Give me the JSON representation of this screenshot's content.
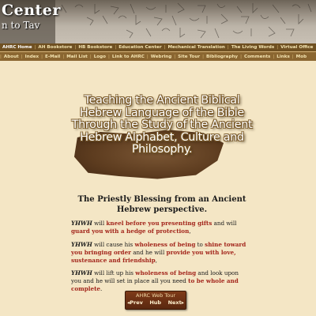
{
  "header": {
    "title": "Center",
    "subtitle": "n to Tav"
  },
  "nav_primary": [
    "AHRC Home",
    "AH Bookstore",
    "HB Bookstore",
    "Education Center",
    "Mechanical Translation",
    "The Living Words",
    "Virtual Office"
  ],
  "nav_secondary": [
    "About",
    "Index",
    "E-Mail",
    "Mail List",
    "Logo",
    "Link to AHRC",
    "Webring",
    "Site Tour",
    "Bibliography",
    "Comments",
    "Links",
    "Mob"
  ],
  "hero": {
    "text": "Teaching the Ancient Biblical Hebrew Language of the Bible Through the Study of the Ancient Hebrew Alphabet, Culture and Philosophy."
  },
  "blessing": {
    "title": "The Priestly Blessing from an Ancient Hebrew perspective.",
    "p1": {
      "a": "YHWH",
      "b": " will ",
      "c": "kneel before you presenting gifts",
      "d": " and will ",
      "e": "guard you with a hedge of protection",
      "f": ","
    },
    "p2": {
      "a": "YHWH",
      "b": " will cause his ",
      "c": "wholeness of being",
      "d": " to ",
      "e": "shine toward you bringing order",
      "f": " and he will ",
      "g": "provide you with love, sustenance and friendship",
      "h": ","
    },
    "p3": {
      "a": "YHWH",
      "b": " will lift up his ",
      "c": "wholeness of being",
      "d": " and look upon you and he will set in place all you need ",
      "e": "to be whole and complete",
      "f": "."
    }
  },
  "tour": {
    "title": "AHRC Web Tour",
    "prev": "Prev",
    "hub": "Hub",
    "next": "Next"
  }
}
